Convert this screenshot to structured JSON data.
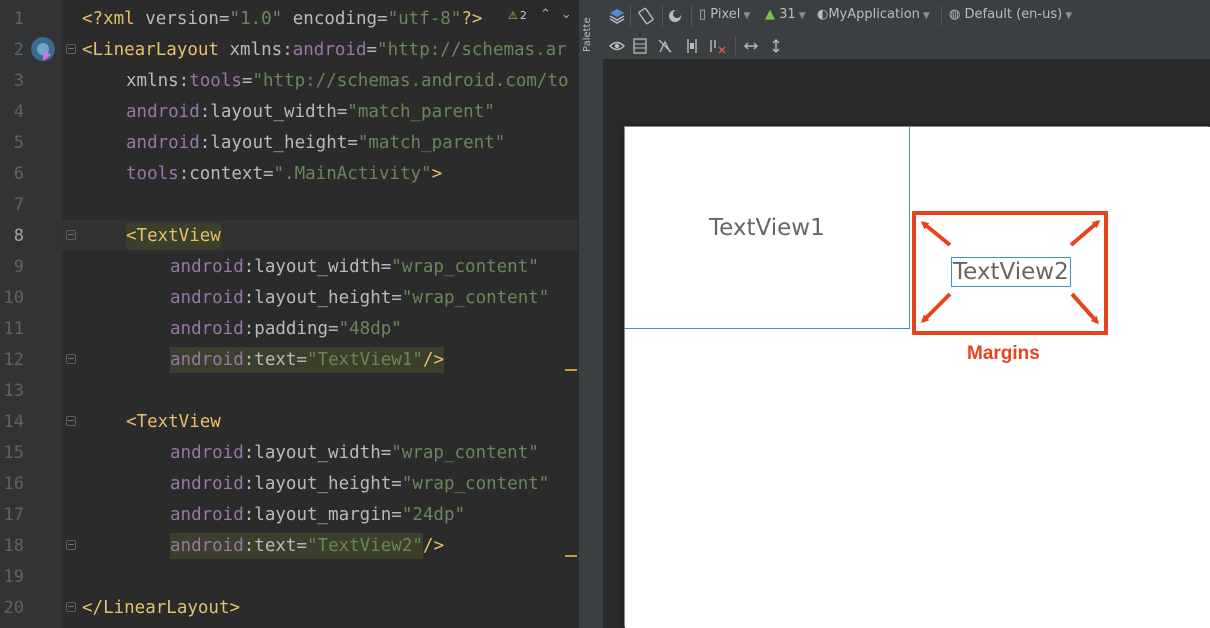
{
  "editor": {
    "warning_count": "2",
    "lines": [
      {
        "n": "1"
      },
      {
        "n": "2"
      },
      {
        "n": "3"
      },
      {
        "n": "4"
      },
      {
        "n": "5"
      },
      {
        "n": "6"
      },
      {
        "n": "7"
      },
      {
        "n": "8"
      },
      {
        "n": "9"
      },
      {
        "n": "10"
      },
      {
        "n": "11"
      },
      {
        "n": "12"
      },
      {
        "n": "13"
      },
      {
        "n": "14"
      },
      {
        "n": "15"
      },
      {
        "n": "16"
      },
      {
        "n": "17"
      },
      {
        "n": "18"
      },
      {
        "n": "19"
      },
      {
        "n": "20"
      }
    ],
    "code": {
      "l1_tag": "<?xml ",
      "l1_attr1": "version",
      "l1_eq1": "=",
      "l1_val1": "\"1.0\"",
      "l1_attr2": " encoding",
      "l1_eq2": "=",
      "l1_val2": "\"utf-8\"",
      "l1_end": "?>",
      "l2_tag": "<LinearLayout ",
      "l2_attr": "xmlns:",
      "l2_ns": "android",
      "l2_eq": "=",
      "l2_val": "\"http://schemas.ar",
      "l3_attr": "xmlns:",
      "l3_ns": "tools",
      "l3_eq": "=",
      "l3_val": "\"http://schemas.android.com/to",
      "l4_ns": "android",
      "l4_attr": ":layout_width",
      "l4_eq": "=",
      "l4_val": "\"match_parent\"",
      "l5_ns": "android",
      "l5_attr": ":layout_height",
      "l5_eq": "=",
      "l5_val": "\"match_parent\"",
      "l6_ns": "tools",
      "l6_attr": ":context",
      "l6_eq": "=",
      "l6_val": "\".MainActivity\"",
      "l6_end": ">",
      "l8_tag": "<TextView",
      "l9_ns": "android",
      "l9_attr": ":layout_width",
      "l9_eq": "=",
      "l9_val": "\"wrap_content\"",
      "l10_ns": "android",
      "l10_attr": ":layout_height",
      "l10_eq": "=",
      "l10_val": "\"wrap_content\"",
      "l11_ns": "android",
      "l11_attr": ":padding",
      "l11_eq": "=",
      "l11_val": "\"48dp\"",
      "l12_ns": "android",
      "l12_attr": ":text",
      "l12_eq": "=",
      "l12_val": "\"TextView1\"",
      "l12_end": "/>",
      "l14_tag": "<TextView",
      "l15_ns": "android",
      "l15_attr": ":layout_width",
      "l15_eq": "=",
      "l15_val": "\"wrap_content\"",
      "l16_ns": "android",
      "l16_attr": ":layout_height",
      "l16_eq": "=",
      "l16_val": "\"wrap_content\"",
      "l17_ns": "android",
      "l17_attr": ":layout_margin",
      "l17_eq": "=",
      "l17_val": "\"24dp\"",
      "l18_ns": "android",
      "l18_attr": ":text",
      "l18_eq": "=",
      "l18_val": "\"TextView2\"",
      "l18_end": "/>",
      "l20_tag": "</LinearLayout>"
    }
  },
  "palette": {
    "label": "Palette"
  },
  "toolbar": {
    "device": "Pixel",
    "api": "31",
    "theme": "MyApplication",
    "locale": "Default (en-us)"
  },
  "canvas": {
    "textview1": "TextView1",
    "textview2": "TextView2",
    "annotation": "Margins"
  },
  "colors": {
    "editor_bg": "#2b2b2b",
    "tag": "#e8bf6a",
    "namespace": "#9876aa",
    "value": "#6a8759",
    "annotation": "#e8431f",
    "selection_outline": "#3d8fd1"
  },
  "icons": [
    "warning-icon",
    "compose-preview-icon",
    "layers-icon",
    "orientation-icon",
    "night-mode-icon",
    "device-icon",
    "android-icon",
    "theme-icon",
    "globe-icon",
    "eye-icon",
    "blueprint-icon",
    "constraints-icon",
    "margins-icon",
    "clear-constraints-icon",
    "horizontal-expand-icon",
    "vertical-expand-icon",
    "fold-icon"
  ]
}
